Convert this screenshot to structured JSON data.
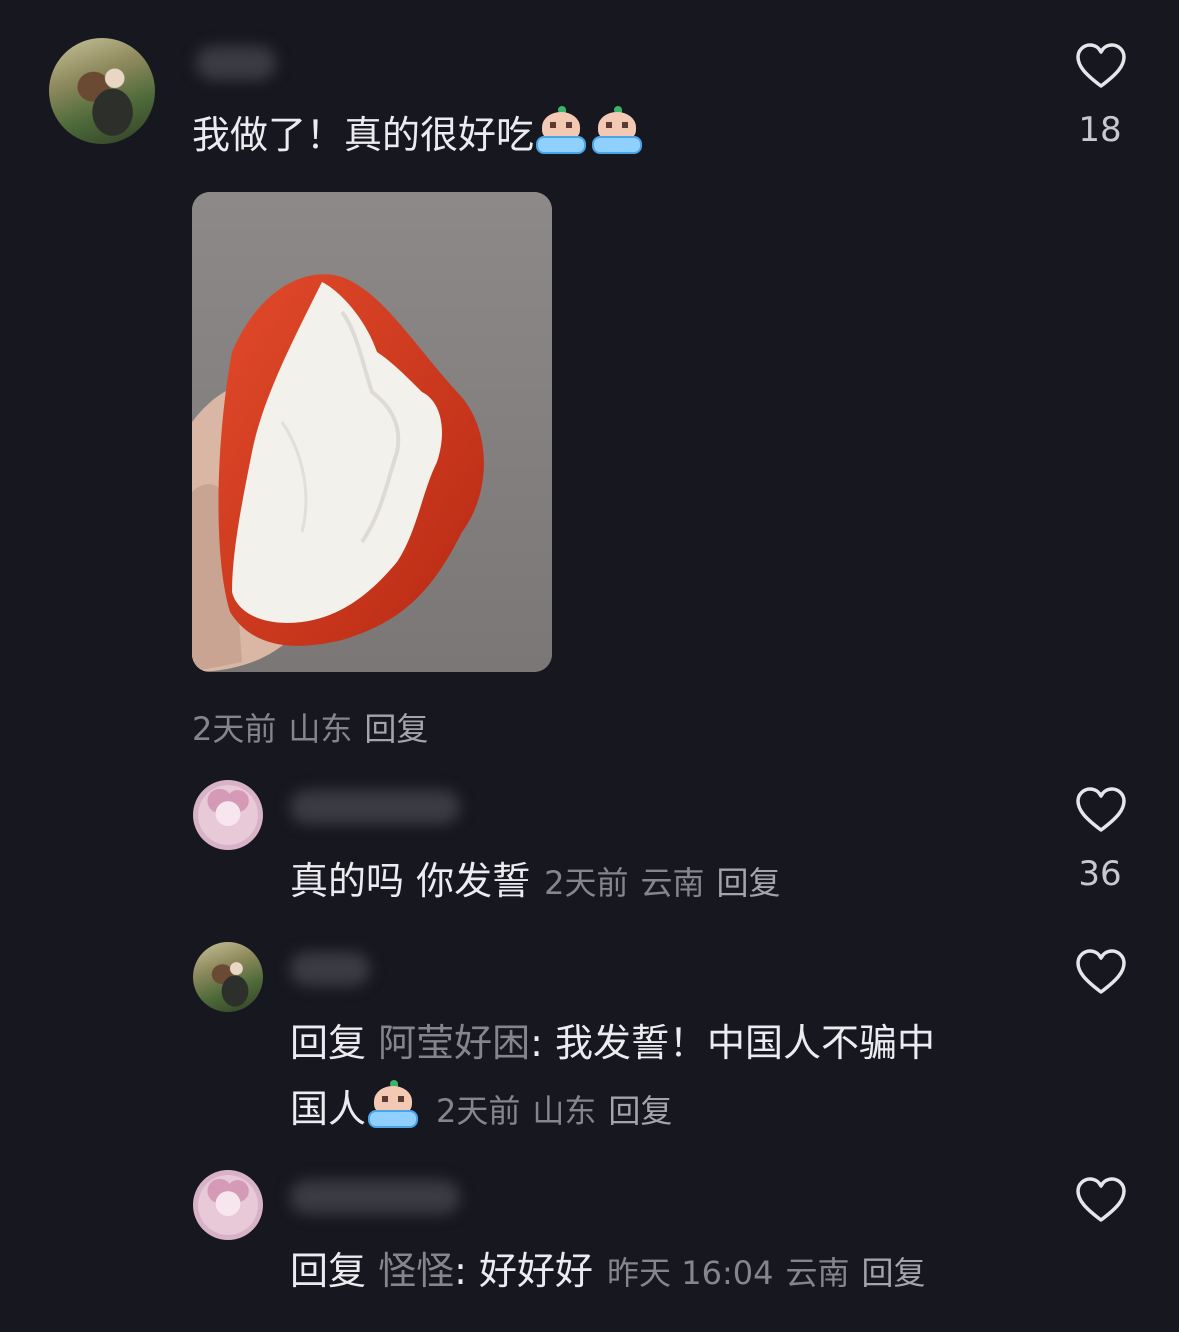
{
  "comment": {
    "text": "我做了！真的很好吃",
    "emoji": [
      "crying-emoji",
      "crying-emoji"
    ],
    "likes": "18",
    "meta": {
      "time": "2天前",
      "location": "山东",
      "reply": "回复"
    }
  },
  "replies": [
    {
      "text": "真的吗 你发誓",
      "meta": {
        "time": "2天前",
        "location": "云南",
        "reply": "回复"
      },
      "likes": "36"
    },
    {
      "prefix": "回复",
      "target": "阿莹好困",
      "colon": ":",
      "text_line1": "我发誓！中国人不骗中",
      "text_line2": "国人",
      "emoji": [
        "crying-emoji"
      ],
      "meta": {
        "time": "2天前",
        "location": "山东",
        "reply": "回复"
      },
      "likes": ""
    },
    {
      "prefix": "回复",
      "target": "怪怪",
      "colon": ":",
      "text": "好好好",
      "meta": {
        "time": "昨天 16:04",
        "location": "云南",
        "reply": "回复"
      },
      "likes": ""
    }
  ],
  "colors": {
    "background": "#17171f",
    "text": "#ececf0",
    "muted": "#85858e",
    "pepper": "#d8391f"
  }
}
